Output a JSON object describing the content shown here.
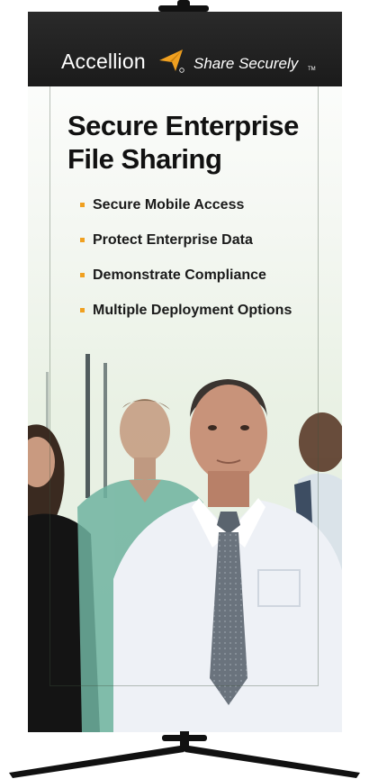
{
  "brand": {
    "name": "Accellion",
    "tagline": "Share Securely",
    "tagline_tm": "TM",
    "logo_icon": "paper-plane-logo-icon",
    "logo_color": "#f0a020"
  },
  "headline": "Secure Enterprise File Sharing",
  "bullets": [
    "Secure Mobile Access",
    "Protect Enterprise Data",
    "Demonstrate Compliance",
    "Multiple Deployment Options"
  ],
  "colors": {
    "header": "#1f1f1f",
    "accent": "#f0a020",
    "text": "#111111"
  }
}
